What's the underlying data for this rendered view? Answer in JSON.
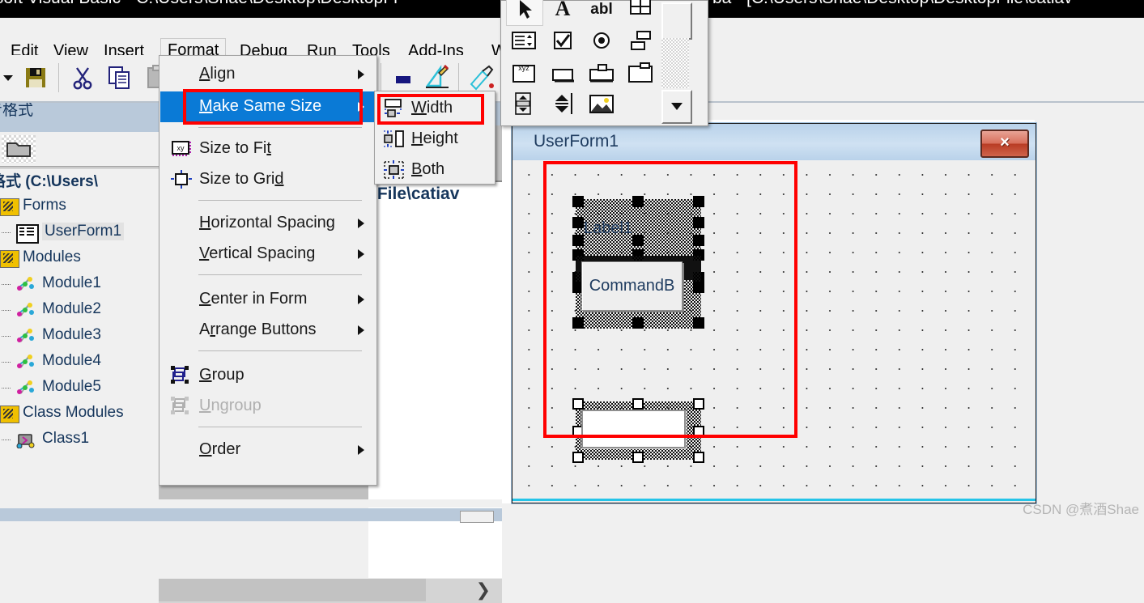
{
  "window": {
    "title_left": "osoft Visual Basic - C:\\Users\\Shae\\Desktop\\DesktopFi",
    "title_right": "ba - [C:\\Users\\Shae\\Desktop\\DesktopFile\\catiav"
  },
  "menubar": {
    "items": [
      {
        "label": "Edit",
        "accel": "E"
      },
      {
        "label": "View",
        "accel": "V"
      },
      {
        "label": "Insert",
        "accel": "I"
      },
      {
        "label": "Format",
        "accel": "o",
        "active": true
      },
      {
        "label": "Debug",
        "accel": "D"
      },
      {
        "label": "Run",
        "accel": "R"
      },
      {
        "label": "Tools",
        "accel": "T"
      },
      {
        "label": "Add-Ins",
        "accel": "A"
      },
      {
        "label": "W",
        "accel": "W"
      }
    ]
  },
  "toolbar": {
    "icons": [
      "dropdown-arrow",
      "save-icon",
      "cut-icon",
      "copy-icon",
      "paste-icon",
      "color-swatch-icon",
      "design-mode-icon",
      "object-browser-icon"
    ],
    "combo_value": "",
    "combo_arrow": "chevron-down-icon"
  },
  "format_menu": {
    "items": [
      {
        "label": "Align",
        "accel": "A",
        "submenu": true,
        "icon": null,
        "disabled": false
      },
      {
        "label": "Make Same Size",
        "accel": "M",
        "submenu": true,
        "icon": null,
        "disabled": false,
        "highlighted": true
      },
      {
        "label": "Size to Fit",
        "accel": "t",
        "submenu": false,
        "icon": "size-to-fit-icon",
        "disabled": false
      },
      {
        "label": "Size to Grid",
        "accel": "d",
        "submenu": false,
        "icon": "size-to-grid-icon",
        "disabled": false
      },
      {
        "label": "Horizontal Spacing",
        "accel": "H",
        "submenu": true,
        "icon": null,
        "disabled": false
      },
      {
        "label": "Vertical Spacing",
        "accel": "V",
        "submenu": true,
        "icon": null,
        "disabled": false
      },
      {
        "label": "Center in Form",
        "accel": "C",
        "submenu": true,
        "icon": null,
        "disabled": false
      },
      {
        "label": "Arrange Buttons",
        "accel": "r",
        "submenu": true,
        "icon": null,
        "disabled": false
      },
      {
        "label": "Group",
        "accel": "G",
        "submenu": false,
        "icon": "group-icon",
        "disabled": false
      },
      {
        "label": "Ungroup",
        "accel": "U",
        "submenu": false,
        "icon": "ungroup-icon",
        "disabled": true
      },
      {
        "label": "Order",
        "accel": "O",
        "submenu": true,
        "icon": null,
        "disabled": false
      }
    ]
  },
  "make_same_size_submenu": {
    "items": [
      {
        "label": "Width",
        "accel": "W",
        "icon": "same-width-icon",
        "highlighted_box": true
      },
      {
        "label": "Height",
        "accel": "H",
        "icon": "same-height-icon",
        "highlighted_box": false
      },
      {
        "label": "Both",
        "accel": "B",
        "icon": "same-both-icon",
        "highlighted_box": false
      }
    ]
  },
  "project_explorer": {
    "title": "专格式",
    "toolbar_icons": [
      "folder-view-icon"
    ],
    "root": "格式 (C:\\Users\\",
    "nodes": [
      {
        "label": "Forms",
        "icon": "forms-folder-icon",
        "indent": 0,
        "selected": false
      },
      {
        "label": "UserForm1",
        "icon": "userform-icon",
        "indent": 1,
        "selected": true
      },
      {
        "label": "Modules",
        "icon": "modules-folder-icon",
        "indent": 0,
        "selected": false
      },
      {
        "label": "Module1",
        "icon": "module-icon",
        "indent": 1,
        "selected": false
      },
      {
        "label": "Module2",
        "icon": "module-icon",
        "indent": 1,
        "selected": false
      },
      {
        "label": "Module3",
        "icon": "module-icon",
        "indent": 1,
        "selected": false
      },
      {
        "label": "Module4",
        "icon": "module-icon",
        "indent": 1,
        "selected": false
      },
      {
        "label": "Module5",
        "icon": "module-icon",
        "indent": 1,
        "selected": false
      },
      {
        "label": "Class Modules",
        "icon": "class-folder-icon",
        "indent": 0,
        "selected": false
      },
      {
        "label": "Class1",
        "icon": "class-icon",
        "indent": 1,
        "selected": false
      }
    ]
  },
  "mid_window": {
    "path_fragment": "pFile\\catiav",
    "scroll_chevron": "chevron-right-icon"
  },
  "toolbox": {
    "tools": [
      "select-arrow-icon",
      "label-icon",
      "textbox-icon",
      "combobox-icon",
      "listbox-icon",
      "checkbox-icon",
      "optionbutton-icon",
      "togglebutton-icon",
      "frame-icon",
      "commandbutton-icon",
      "tabstrip-icon",
      "multipage-icon",
      "scrollbar-icon",
      "spinbutton-icon",
      "image-icon"
    ],
    "selected_tool": "select-arrow-icon",
    "scroll_down": "scroll-down-arrow-icon"
  },
  "userform": {
    "caption": "UserForm1",
    "close_button": "×",
    "controls": [
      {
        "name": "Label1",
        "type": "label",
        "text": "Label1",
        "selected": true,
        "handle_style": "filled"
      },
      {
        "name": "CommandButton1",
        "type": "commandbutton",
        "text": "CommandB",
        "selected": true,
        "handle_style": "filled"
      },
      {
        "name": "TextBox1",
        "type": "textbox",
        "text": "",
        "selected": true,
        "handle_style": "hollow"
      }
    ]
  },
  "watermark": "CSDN @煮酒Shae"
}
